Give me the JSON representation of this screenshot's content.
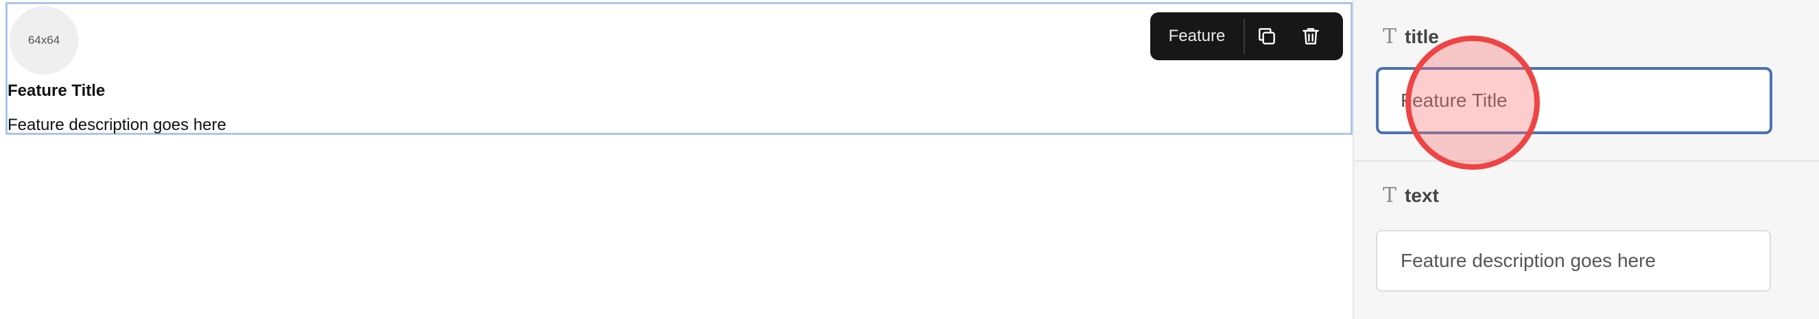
{
  "canvas": {
    "image_placeholder": "64x64",
    "feature_title": "Feature Title",
    "feature_description": "Feature description goes here"
  },
  "toolbar": {
    "label": "Feature",
    "duplicate_icon": "copy-icon",
    "delete_icon": "trash-icon"
  },
  "panel": {
    "fields": [
      {
        "icon": "T",
        "label": "title",
        "value": "Feature Title"
      },
      {
        "icon": "T",
        "label": "text",
        "value": "Feature description goes here"
      }
    ]
  },
  "colors": {
    "selection_outline": "#a9c5ec",
    "toolbar_bg": "#171717",
    "focus_border": "#4a72b0",
    "click_indicator": "#ef4444"
  }
}
